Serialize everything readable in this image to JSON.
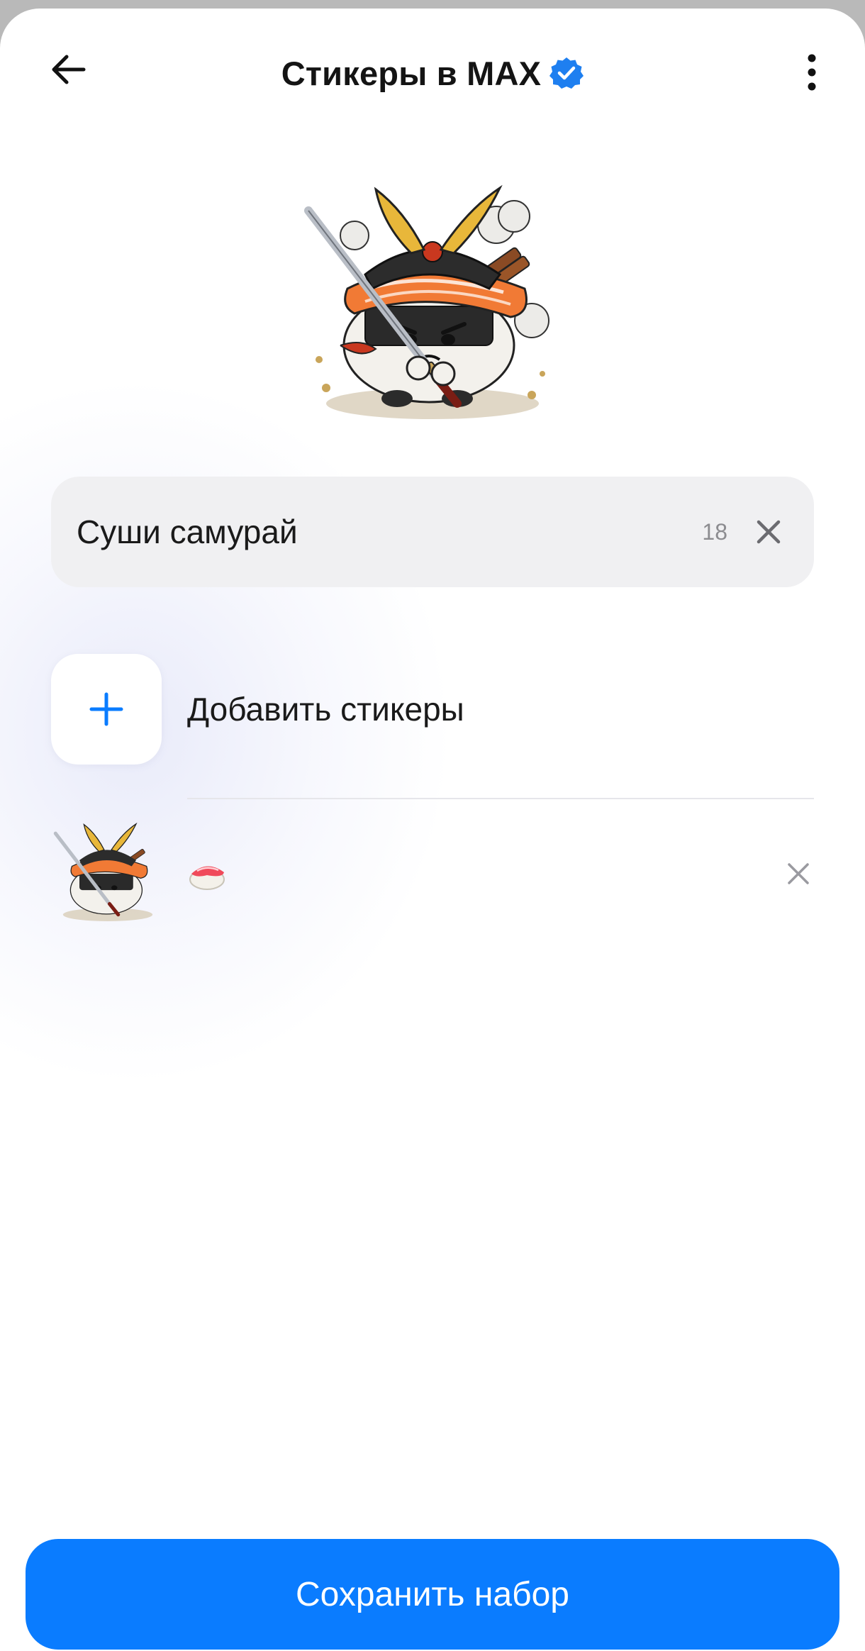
{
  "header": {
    "title": "Стикеры в MAX",
    "back_icon": "arrow-left-icon",
    "verified_icon": "verified-badge-icon",
    "more_icon": "more-vertical-icon"
  },
  "hero": {
    "image": "sushi-samurai-sticker"
  },
  "name_field": {
    "value": "Суши самурай",
    "char_count": "18",
    "clear_icon": "close-icon"
  },
  "add_stickers": {
    "label": "Добавить стикеры",
    "icon": "plus-icon"
  },
  "stickers": [
    {
      "image": "sushi-samurai-sticker",
      "emoji_icon": "sushi-emoji-icon",
      "remove_icon": "close-icon"
    }
  ],
  "save_button": {
    "label": "Сохранить набор"
  },
  "colors": {
    "accent": "#0a7cff",
    "field_bg": "#f0f0f2",
    "verified": "#1e7ff0"
  }
}
